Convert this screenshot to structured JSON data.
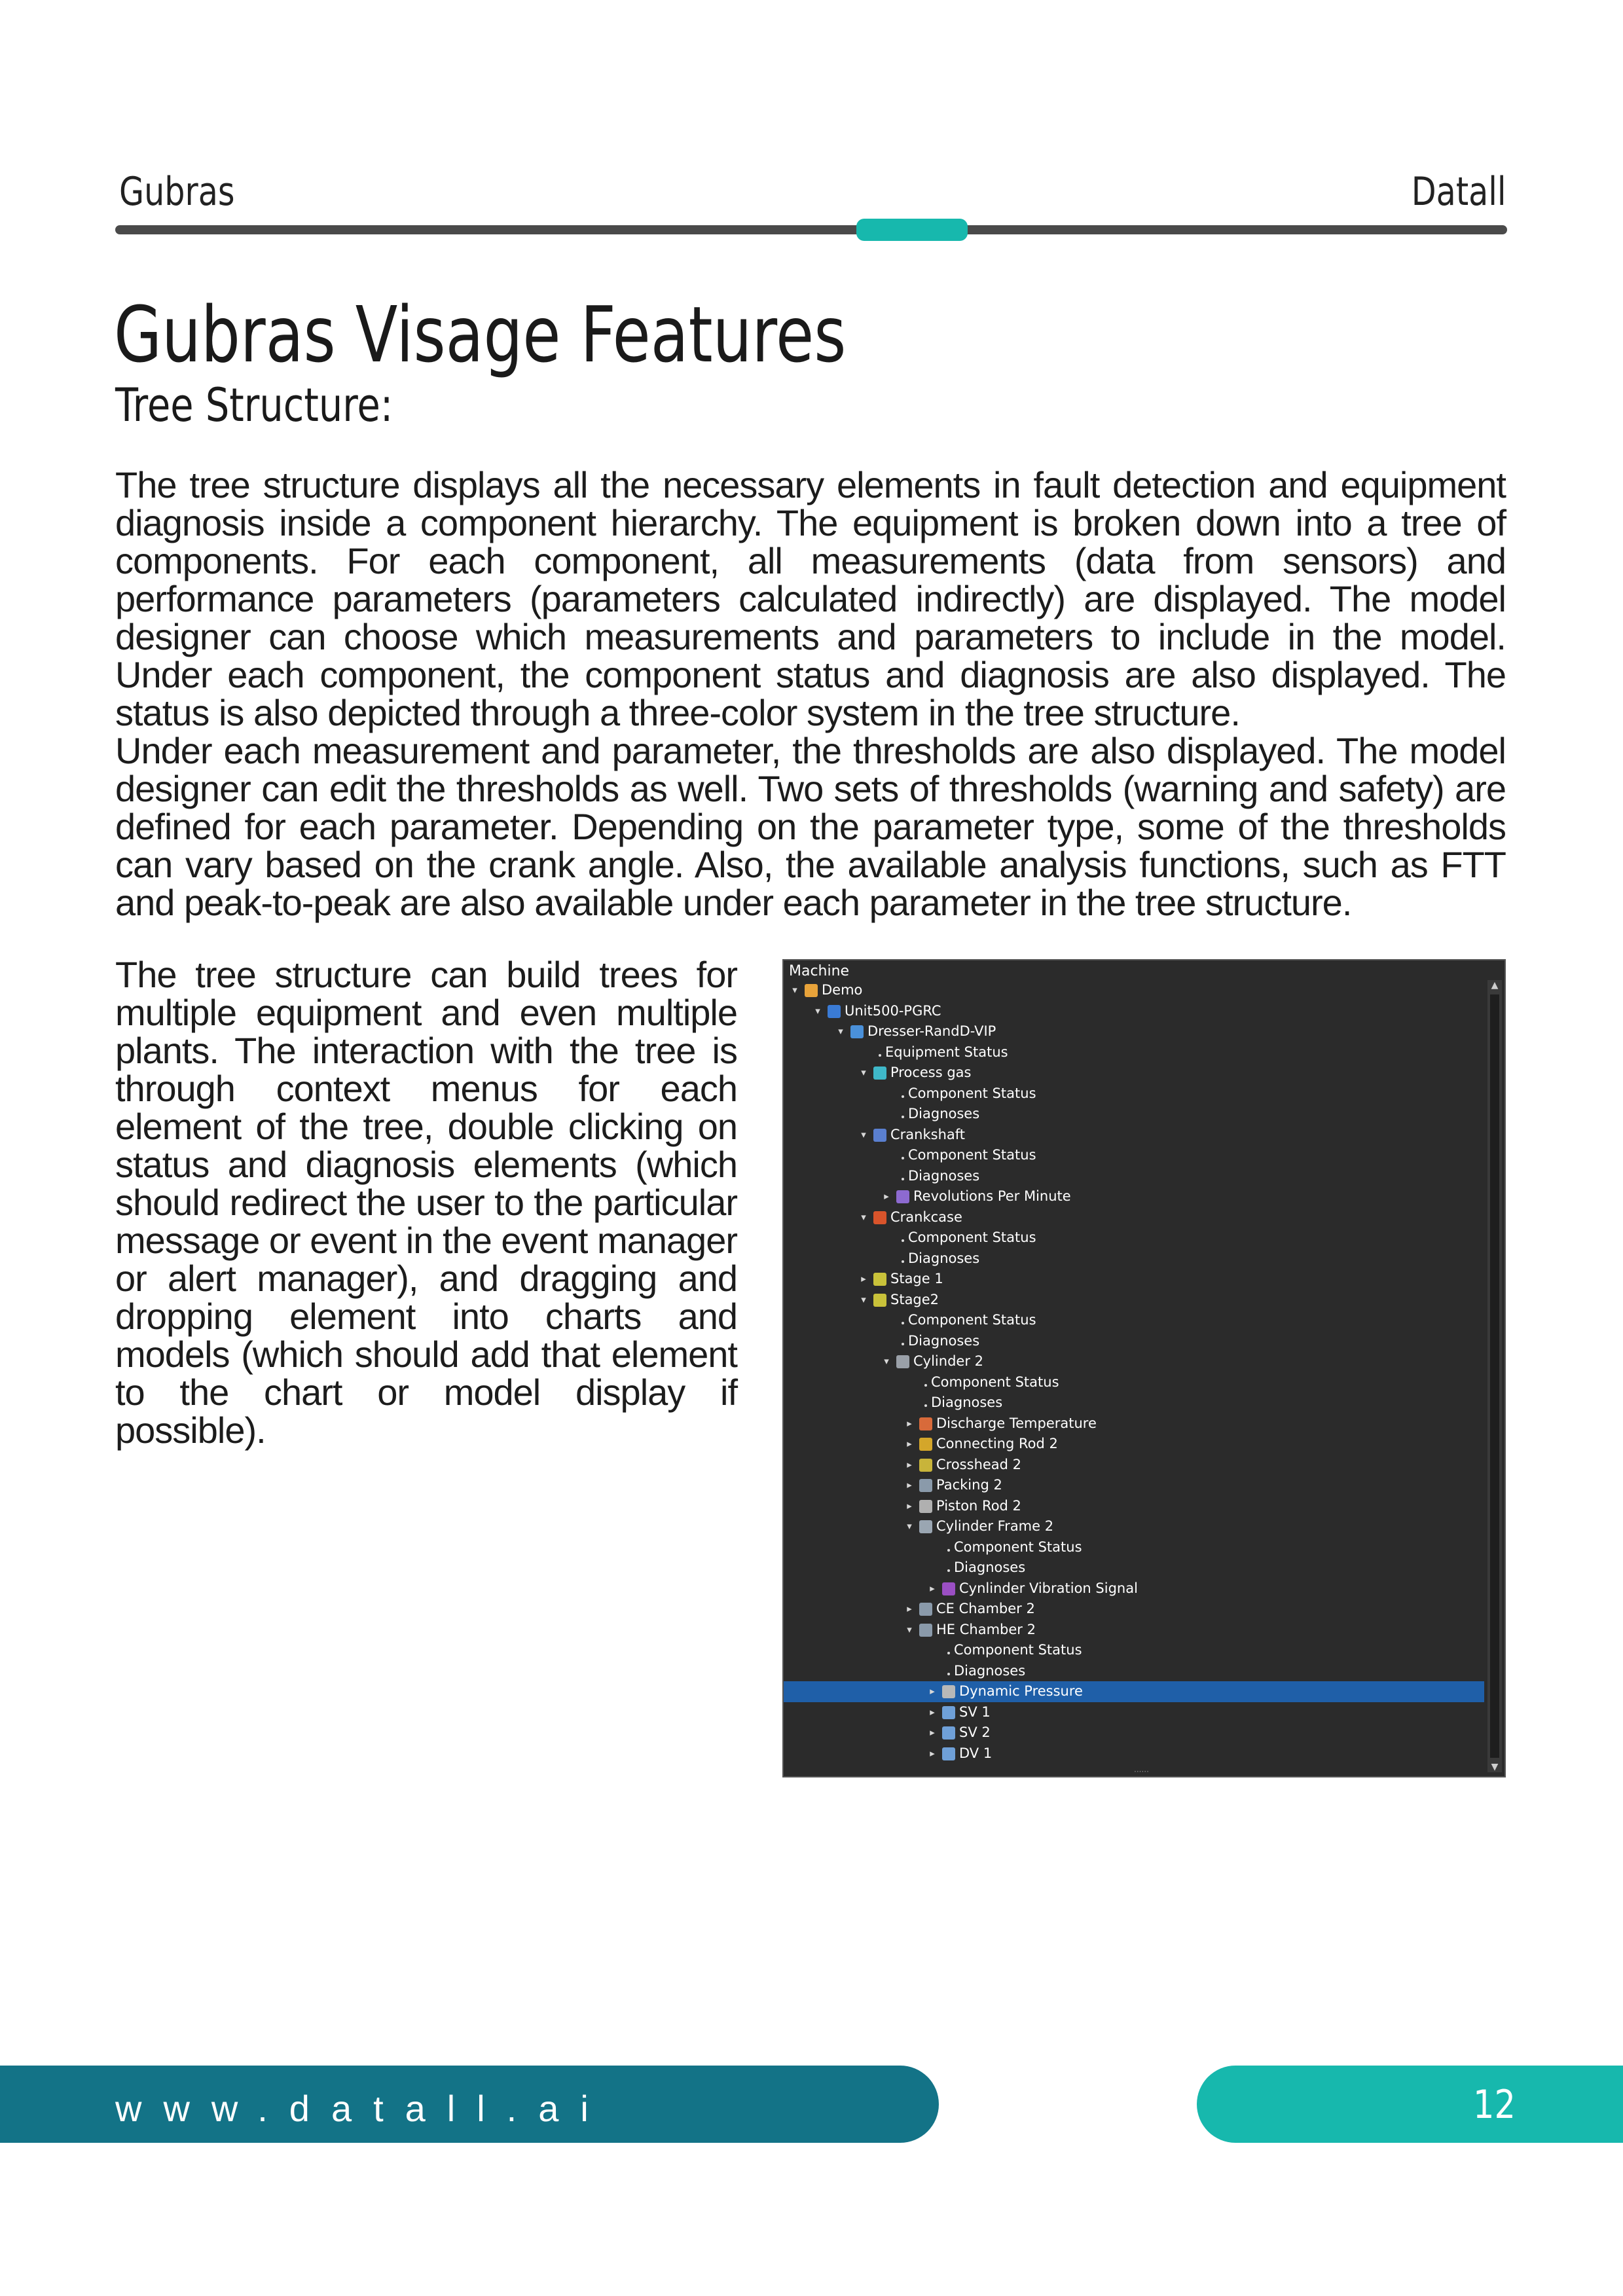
{
  "header": {
    "left": "Gubras",
    "right": "Datall"
  },
  "title": "Gubras Visage Features",
  "subtitle": "Tree Structure:",
  "paragraphs": [
    "The tree structure displays all the necessary elements in fault detection and equipment diagnosis inside a component hierarchy. The equipment is broken down into a tree of components. For each component, all measurements (data from sensors) and performance parameters (parameters calculated indirectly) are displayed. The model designer can choose which measurements and parameters to include in the model. Under each component, the component status and diagnosis are also displayed. The status is also depicted through a three-color system in the tree structure.",
    "Under each measurement and parameter, the thresholds are also displayed. The model designer can edit the thresholds as well. Two sets of thresholds (warning and safety) are defined for each parameter. Depending on the parameter type, some of the thresholds can vary based on the crank angle. Also, the available analysis functions, such as FTT and peak-to-peak are also available under each parameter in the tree structure.",
    "The tree structure can build trees for multiple equipment and even multiple plants. The interaction with the tree is through context menus for each element of the tree, double clicking on status and diagnosis elements (which should redirect the user to the particular message or event in the event manager or alert manager), and dragging and dropping element into charts and models (which should add that element to the chart or model display if possible)."
  ],
  "tree": {
    "title": "Machine",
    "nodes": [
      {
        "label": "Demo",
        "level": 0,
        "toggle": "expanded",
        "icon": "folder-icon",
        "color": "#e8a33a"
      },
      {
        "label": "Unit500-PGRC",
        "level": 1,
        "toggle": "expanded",
        "icon": "unit-icon",
        "color": "#3a7bd5"
      },
      {
        "label": "Dresser-RandD-VIP",
        "level": 2,
        "toggle": "expanded",
        "icon": "compressor-icon",
        "color": "#4a90d9"
      },
      {
        "label": "Equipment Status",
        "level": 3,
        "toggle": "none",
        "icon": "bullet"
      },
      {
        "label": "Process gas",
        "level": 3,
        "toggle": "expanded",
        "icon": "gas-icon",
        "color": "#3fb8c9"
      },
      {
        "label": "Component Status",
        "level": 4,
        "toggle": "none",
        "icon": "bullet"
      },
      {
        "label": "Diagnoses",
        "level": 4,
        "toggle": "none",
        "icon": "bullet"
      },
      {
        "label": "Crankshaft",
        "level": 3,
        "toggle": "expanded",
        "icon": "crankshaft-icon",
        "color": "#5a7fd0"
      },
      {
        "label": "Component Status",
        "level": 4,
        "toggle": "none",
        "icon": "bullet"
      },
      {
        "label": "Diagnoses",
        "level": 4,
        "toggle": "none",
        "icon": "bullet"
      },
      {
        "label": "Revolutions Per Minute",
        "level": 4,
        "toggle": "collapsed",
        "icon": "rpm-icon",
        "color": "#8d6ad0"
      },
      {
        "label": "Crankcase",
        "level": 3,
        "toggle": "expanded",
        "icon": "crankcase-icon",
        "color": "#d9542b"
      },
      {
        "label": "Component Status",
        "level": 4,
        "toggle": "none",
        "icon": "bullet"
      },
      {
        "label": "Diagnoses",
        "level": 4,
        "toggle": "none",
        "icon": "bullet"
      },
      {
        "label": "Stage 1",
        "level": 3,
        "toggle": "collapsed",
        "icon": "stage-icon",
        "color": "#c9c23a"
      },
      {
        "label": "Stage2",
        "level": 3,
        "toggle": "expanded",
        "icon": "stage-icon",
        "color": "#c9c23a"
      },
      {
        "label": "Component Status",
        "level": 4,
        "toggle": "none",
        "icon": "bullet"
      },
      {
        "label": "Diagnoses",
        "level": 4,
        "toggle": "none",
        "icon": "bullet"
      },
      {
        "label": "Cylinder 2",
        "level": 4,
        "toggle": "expanded",
        "icon": "cylinder-icon",
        "color": "#9aa0a8"
      },
      {
        "label": "Component Status",
        "level": 5,
        "toggle": "none",
        "icon": "bullet"
      },
      {
        "label": "Diagnoses",
        "level": 5,
        "toggle": "none",
        "icon": "bullet"
      },
      {
        "label": "Discharge Temperature",
        "level": 5,
        "toggle": "collapsed",
        "icon": "temperature-icon",
        "color": "#d86a3a"
      },
      {
        "label": "Connecting Rod 2",
        "level": 5,
        "toggle": "collapsed",
        "icon": "connecting-rod-icon",
        "color": "#d4a62a"
      },
      {
        "label": "Crosshead 2",
        "level": 5,
        "toggle": "collapsed",
        "icon": "crosshead-icon",
        "color": "#c8b43a"
      },
      {
        "label": "Packing 2",
        "level": 5,
        "toggle": "collapsed",
        "icon": "packing-icon",
        "color": "#8a9aaa"
      },
      {
        "label": "Piston Rod 2",
        "level": 5,
        "toggle": "collapsed",
        "icon": "piston-rod-icon",
        "color": "#b0b0b0"
      },
      {
        "label": "Cylinder Frame 2",
        "level": 5,
        "toggle": "expanded",
        "icon": "cylinder-frame-icon",
        "color": "#9aa6b2"
      },
      {
        "label": "Component Status",
        "level": 6,
        "toggle": "none",
        "icon": "bullet"
      },
      {
        "label": "Diagnoses",
        "level": 6,
        "toggle": "none",
        "icon": "bullet"
      },
      {
        "label": "Cynlinder Vibration Signal",
        "level": 6,
        "toggle": "collapsed",
        "icon": "vibration-icon",
        "color": "#9b4fc4"
      },
      {
        "label": "CE Chamber 2",
        "level": 5,
        "toggle": "collapsed",
        "icon": "chamber-icon",
        "color": "#8a9aaa"
      },
      {
        "label": "HE Chamber 2",
        "level": 5,
        "toggle": "expanded",
        "icon": "chamber-icon",
        "color": "#8a9aaa"
      },
      {
        "label": "Component Status",
        "level": 6,
        "toggle": "none",
        "icon": "bullet"
      },
      {
        "label": "Diagnoses",
        "level": 6,
        "toggle": "none",
        "icon": "bullet"
      },
      {
        "label": "Dynamic Pressure",
        "level": 6,
        "toggle": "collapsed",
        "icon": "pressure-icon",
        "color": "#b8b8b8",
        "selected": true
      },
      {
        "label": "SV 1",
        "level": 6,
        "toggle": "collapsed",
        "icon": "valve-icon",
        "color": "#6fa0d8"
      },
      {
        "label": "SV 2",
        "level": 6,
        "toggle": "collapsed",
        "icon": "valve-icon",
        "color": "#6fa0d8"
      },
      {
        "label": "DV 1",
        "level": 6,
        "toggle": "collapsed",
        "icon": "valve-icon",
        "color": "#6fa0d8"
      }
    ]
  },
  "footer": {
    "url": "www.datall.ai",
    "page": "12"
  },
  "colors": {
    "teal": "#17b8ad",
    "dark_teal": "#137387",
    "rule": "#4a4a4a"
  }
}
